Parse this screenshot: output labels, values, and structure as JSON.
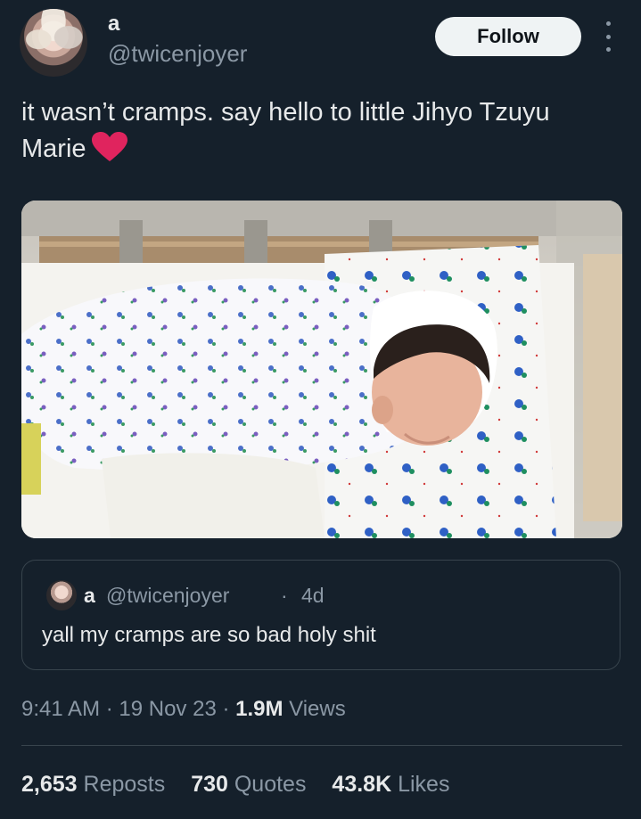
{
  "author": {
    "display_name": "a",
    "handle": "@twicenjoyer"
  },
  "follow_label": "Follow",
  "tweet": {
    "text": "it wasn’t cramps. say hello to little Jihyo Tzuyu Marie",
    "emoji": "heart-icon"
  },
  "quoted_tweet": {
    "display_name": "a",
    "handle": "@twicenjoyer",
    "separator": "·",
    "time": "4d",
    "text": "yall my cramps are so bad holy shit"
  },
  "meta": {
    "time": "9:41 AM",
    "sep1": " · ",
    "date": "19 Nov 23",
    "sep2": " · ",
    "views_count": "1.9M",
    "views_label": " Views"
  },
  "stats": [
    {
      "count": "2,653",
      "label": "Reposts"
    },
    {
      "count": "730",
      "label": "Quotes"
    },
    {
      "count": "43.8K",
      "label": "Likes"
    }
  ],
  "colors": {
    "background": "#15202b",
    "text_primary": "#e7e9ea",
    "text_secondary": "#8b98a5",
    "border": "#38444d",
    "heart": "#f91880"
  }
}
